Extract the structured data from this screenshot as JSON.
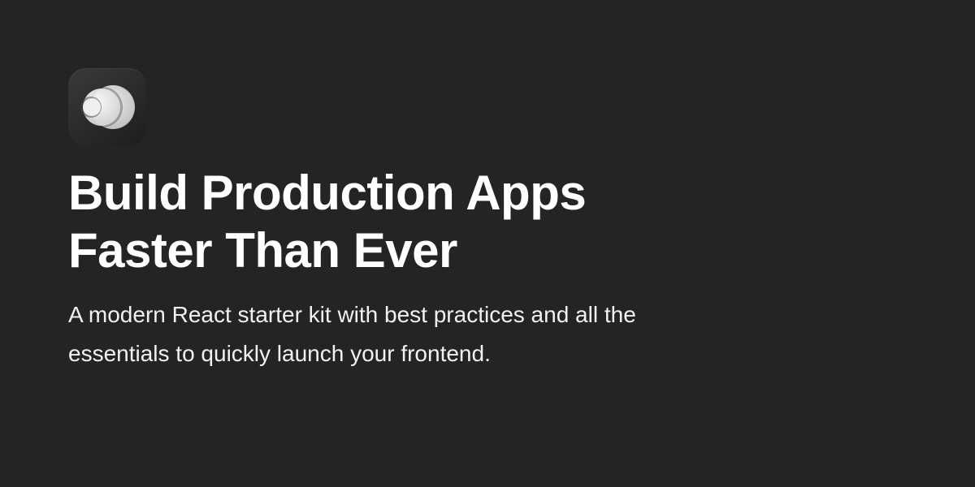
{
  "logo": {
    "icon": "overlapping-circles-icon"
  },
  "hero": {
    "title_line_1": "Build Production Apps",
    "title_line_2": "Faster Than Ever",
    "subtitle_line_1": "A modern React starter kit with best practices and all the",
    "subtitle_line_2": "essentials to quickly launch your frontend."
  },
  "colors": {
    "background": "#242424",
    "text": "#ffffff"
  }
}
